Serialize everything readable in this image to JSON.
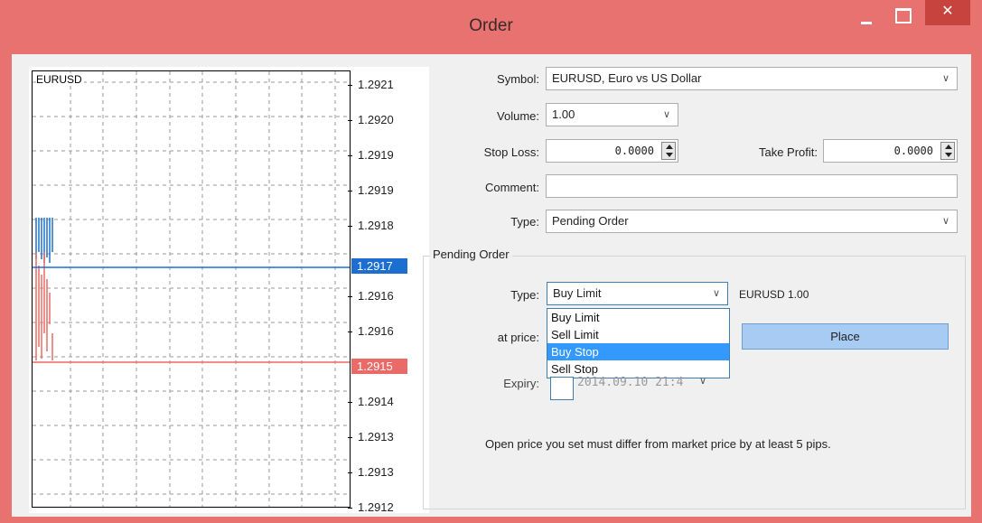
{
  "window": {
    "title": "Order",
    "close_glyph": "✕"
  },
  "chart": {
    "symbol": "EURUSD",
    "price_ticks": [
      "1.2921",
      "1.2920",
      "1.2919",
      "1.2919",
      "1.2918",
      "1.2917",
      "1.2916",
      "1.2916",
      "1.2915",
      "1.2914",
      "1.2913",
      "1.2913",
      "1.2912"
    ],
    "ask_price": "1.2917",
    "bid_price": "1.2915",
    "ask_color": "#1c6fd1",
    "bid_color": "#e96a66"
  },
  "form": {
    "symbol_label": "Symbol:",
    "symbol_value": "EURUSD, Euro vs US Dollar",
    "volume_label": "Volume:",
    "volume_value": "1.00",
    "stop_loss_label": "Stop Loss:",
    "stop_loss_value": "0.0000",
    "take_profit_label": "Take Profit:",
    "take_profit_value": "0.0000",
    "comment_label": "Comment:",
    "comment_value": "",
    "type_label": "Type:",
    "type_value": "Pending Order"
  },
  "pending": {
    "group_title": "Pending Order",
    "type_label": "Type:",
    "type_value": "Buy Limit",
    "type_summary": "EURUSD 1.00",
    "options": [
      "Buy Limit",
      "Sell Limit",
      "Buy Stop",
      "Sell Stop"
    ],
    "highlighted_option": "Buy Stop",
    "at_price_label": "at price:",
    "place_button": "Place",
    "expiry_label": "Expiry:",
    "expiry_value": "2014.09.10 21:4",
    "info_text": "Open price you set must differ from market price by at least 5 pips."
  }
}
